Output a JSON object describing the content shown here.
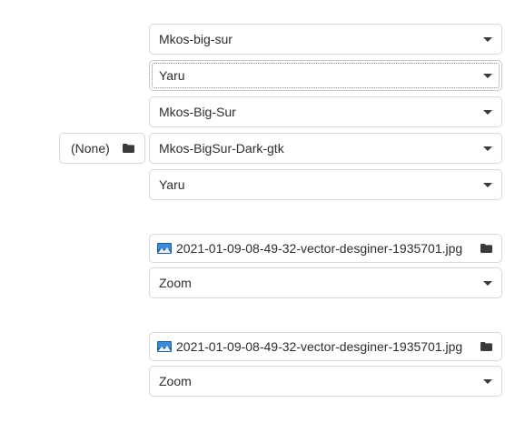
{
  "theme_settings": {
    "rows": [
      {
        "value": "Mkos-big-sur"
      },
      {
        "value": "Yaru"
      },
      {
        "value": "Mkos-Big-Sur"
      },
      {
        "value": "Mkos-BigSur-Dark-gtk"
      },
      {
        "value": "Yaru"
      }
    ],
    "none_button_label": "(None)"
  },
  "background": {
    "file_name": "2021-01-09-08-49-32-vector-desginer-1935701.jpg",
    "mode": "Zoom"
  },
  "lock_screen": {
    "file_name": "2021-01-09-08-49-32-vector-desginer-1935701.jpg",
    "mode": "Zoom"
  },
  "icons": {
    "dropdown": "chevron-down-icon",
    "folder": "folder-icon",
    "image": "image-file-icon"
  }
}
